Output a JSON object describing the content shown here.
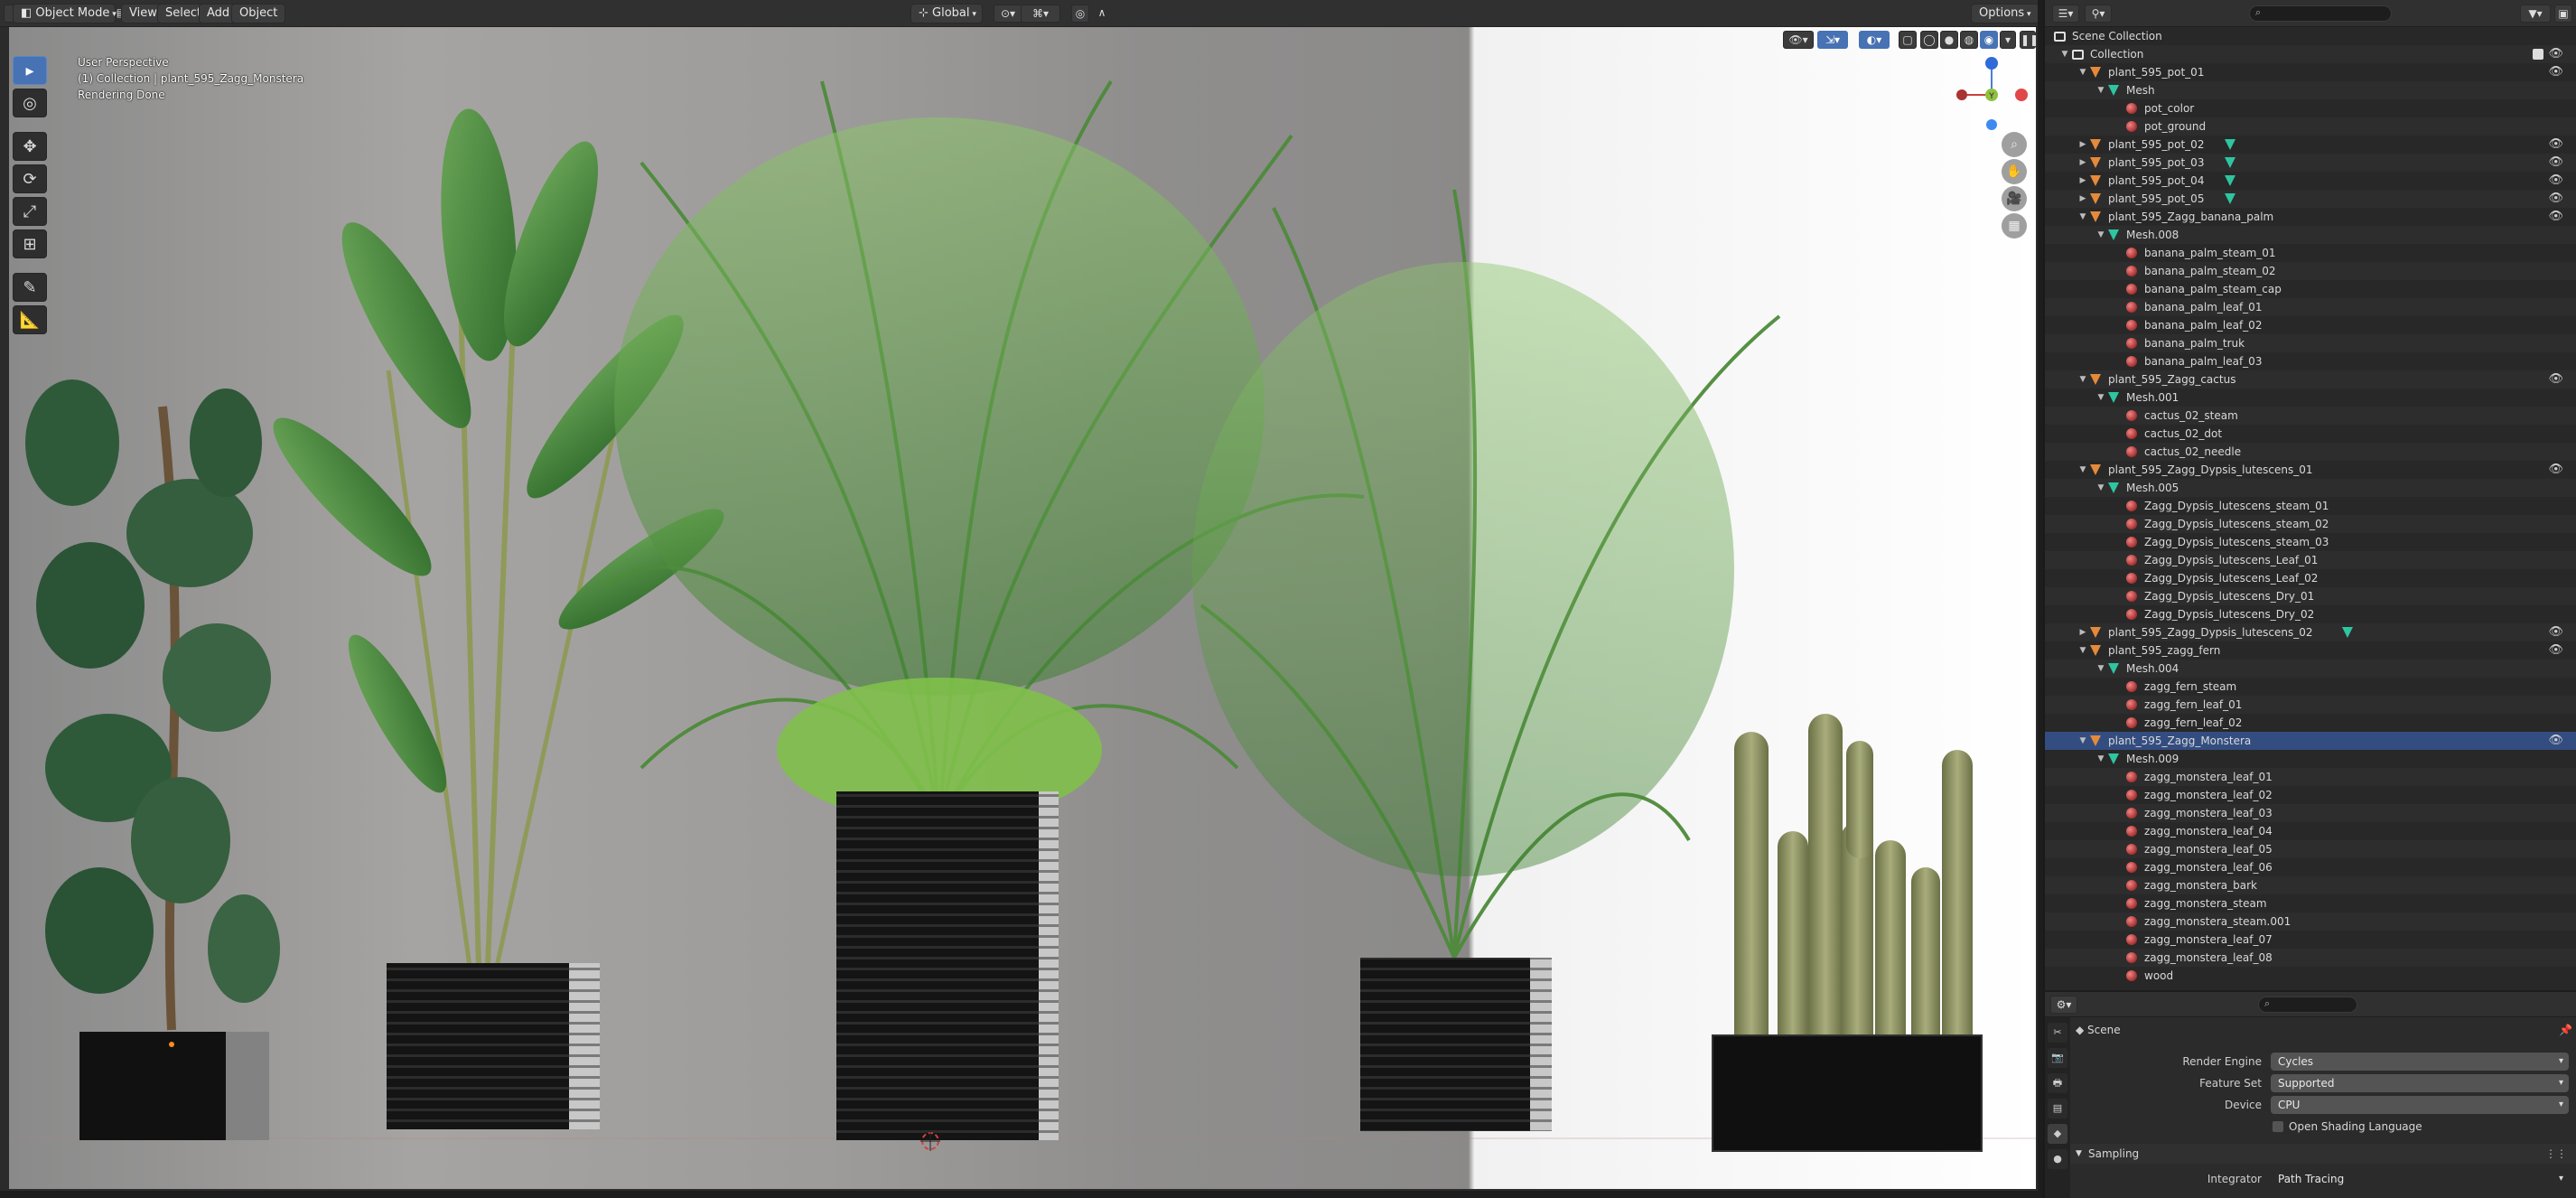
{
  "viewport": {
    "header": {
      "mode": "Object Mode",
      "menus": [
        "View",
        "Select",
        "Add",
        "Object"
      ],
      "orientation": "Global",
      "options": "Options"
    },
    "overlay": {
      "line1": "User Perspective",
      "line2": "(1) Collection | plant_595_Zagg_Monstera",
      "line3": "Rendering Done"
    },
    "gizmo": {
      "z": "Z",
      "y": "Y",
      "x": "X"
    }
  },
  "outliner": {
    "rows": [
      {
        "type": "scene",
        "label": "Scene Collection",
        "depth": 0
      },
      {
        "type": "coll",
        "label": "Collection",
        "depth": 1,
        "tri": "▼"
      },
      {
        "type": "obj",
        "label": "plant_595_pot_01",
        "depth": 2,
        "tri": "▼",
        "eye": true
      },
      {
        "type": "mesh",
        "label": "Mesh",
        "depth": 3,
        "tri": "▼"
      },
      {
        "type": "mat",
        "label": "pot_color",
        "depth": 4
      },
      {
        "type": "mat",
        "label": "pot_ground",
        "depth": 4
      },
      {
        "type": "obj",
        "label": "plant_595_pot_02",
        "depth": 2,
        "tri": "▶",
        "eye": true,
        "meshchip": true
      },
      {
        "type": "obj",
        "label": "plant_595_pot_03",
        "depth": 2,
        "tri": "▶",
        "eye": true,
        "meshchip": true
      },
      {
        "type": "obj",
        "label": "plant_595_pot_04",
        "depth": 2,
        "tri": "▶",
        "eye": true,
        "meshchip": true
      },
      {
        "type": "obj",
        "label": "plant_595_pot_05",
        "depth": 2,
        "tri": "▶",
        "eye": true,
        "meshchip": true
      },
      {
        "type": "obj",
        "label": "plant_595_Zagg_banana_palm",
        "depth": 2,
        "tri": "▼",
        "eye": true
      },
      {
        "type": "mesh",
        "label": "Mesh.008",
        "depth": 3,
        "tri": "▼"
      },
      {
        "type": "mat",
        "label": "banana_palm_steam_01",
        "depth": 4
      },
      {
        "type": "mat",
        "label": "banana_palm_steam_02",
        "depth": 4
      },
      {
        "type": "mat",
        "label": "banana_palm_steam_cap",
        "depth": 4
      },
      {
        "type": "mat",
        "label": "banana_palm_leaf_01",
        "depth": 4
      },
      {
        "type": "mat",
        "label": "banana_palm_leaf_02",
        "depth": 4
      },
      {
        "type": "mat",
        "label": "banana_palm_truk",
        "depth": 4
      },
      {
        "type": "mat",
        "label": "banana_palm_leaf_03",
        "depth": 4
      },
      {
        "type": "obj",
        "label": "plant_595_Zagg_cactus",
        "depth": 2,
        "tri": "▼",
        "eye": true
      },
      {
        "type": "mesh",
        "label": "Mesh.001",
        "depth": 3,
        "tri": "▼"
      },
      {
        "type": "mat",
        "label": "cactus_02_steam",
        "depth": 4
      },
      {
        "type": "mat",
        "label": "cactus_02_dot",
        "depth": 4
      },
      {
        "type": "mat",
        "label": "cactus_02_needle",
        "depth": 4
      },
      {
        "type": "obj",
        "label": "plant_595_Zagg_Dypsis_lutescens_01",
        "depth": 2,
        "tri": "▼",
        "eye": true
      },
      {
        "type": "mesh",
        "label": "Mesh.005",
        "depth": 3,
        "tri": "▼"
      },
      {
        "type": "mat",
        "label": "Zagg_Dypsis_lutescens_steam_01",
        "depth": 4
      },
      {
        "type": "mat",
        "label": "Zagg_Dypsis_lutescens_steam_02",
        "depth": 4
      },
      {
        "type": "mat",
        "label": "Zagg_Dypsis_lutescens_steam_03",
        "depth": 4
      },
      {
        "type": "mat",
        "label": "Zagg_Dypsis_lutescens_Leaf_01",
        "depth": 4
      },
      {
        "type": "mat",
        "label": "Zagg_Dypsis_lutescens_Leaf_02",
        "depth": 4
      },
      {
        "type": "mat",
        "label": "Zagg_Dypsis_lutescens_Dry_01",
        "depth": 4
      },
      {
        "type": "mat",
        "label": "Zagg_Dypsis_lutescens_Dry_02",
        "depth": 4
      },
      {
        "type": "obj",
        "label": "plant_595_Zagg_Dypsis_lutescens_02",
        "depth": 2,
        "tri": "▶",
        "eye": true,
        "meshchip": true
      },
      {
        "type": "obj",
        "label": "plant_595_zagg_fern",
        "depth": 2,
        "tri": "▼",
        "eye": true
      },
      {
        "type": "mesh",
        "label": "Mesh.004",
        "depth": 3,
        "tri": "▼"
      },
      {
        "type": "mat",
        "label": "zagg_fern_steam",
        "depth": 4
      },
      {
        "type": "mat",
        "label": "zagg_fern_leaf_01",
        "depth": 4
      },
      {
        "type": "mat",
        "label": "zagg_fern_leaf_02",
        "depth": 4
      },
      {
        "type": "obj",
        "label": "plant_595_Zagg_Monstera",
        "depth": 2,
        "tri": "▼",
        "eye": true,
        "active": true
      },
      {
        "type": "mesh",
        "label": "Mesh.009",
        "depth": 3,
        "tri": "▼"
      },
      {
        "type": "mat",
        "label": "zagg_monstera_leaf_01",
        "depth": 4
      },
      {
        "type": "mat",
        "label": "zagg_monstera_leaf_02",
        "depth": 4
      },
      {
        "type": "mat",
        "label": "zagg_monstera_leaf_03",
        "depth": 4
      },
      {
        "type": "mat",
        "label": "zagg_monstera_leaf_04",
        "depth": 4
      },
      {
        "type": "mat",
        "label": "zagg_monstera_leaf_05",
        "depth": 4
      },
      {
        "type": "mat",
        "label": "zagg_monstera_leaf_06",
        "depth": 4
      },
      {
        "type": "mat",
        "label": "zagg_monstera_bark",
        "depth": 4
      },
      {
        "type": "mat",
        "label": "zagg_monstera_steam",
        "depth": 4
      },
      {
        "type": "mat",
        "label": "zagg_monstera_steam.001",
        "depth": 4
      },
      {
        "type": "mat",
        "label": "zagg_monstera_leaf_07",
        "depth": 4
      },
      {
        "type": "mat",
        "label": "zagg_monstera_leaf_08",
        "depth": 4
      },
      {
        "type": "mat",
        "label": "wood",
        "depth": 4
      }
    ]
  },
  "properties": {
    "context": "Scene",
    "fields": [
      {
        "label": "Render Engine",
        "value": "Cycles"
      },
      {
        "label": "Feature Set",
        "value": "Supported"
      },
      {
        "label": "Device",
        "value": "CPU"
      }
    ],
    "checkbox": "Open Shading Language",
    "section": "Sampling",
    "integrator": {
      "label": "Integrator",
      "value": "Path Tracing"
    }
  },
  "colors": {
    "accent": "#4772b3",
    "object_icon": "#e58a3a",
    "mesh_icon": "#2ec5a0",
    "material_icon": "#c84848"
  }
}
